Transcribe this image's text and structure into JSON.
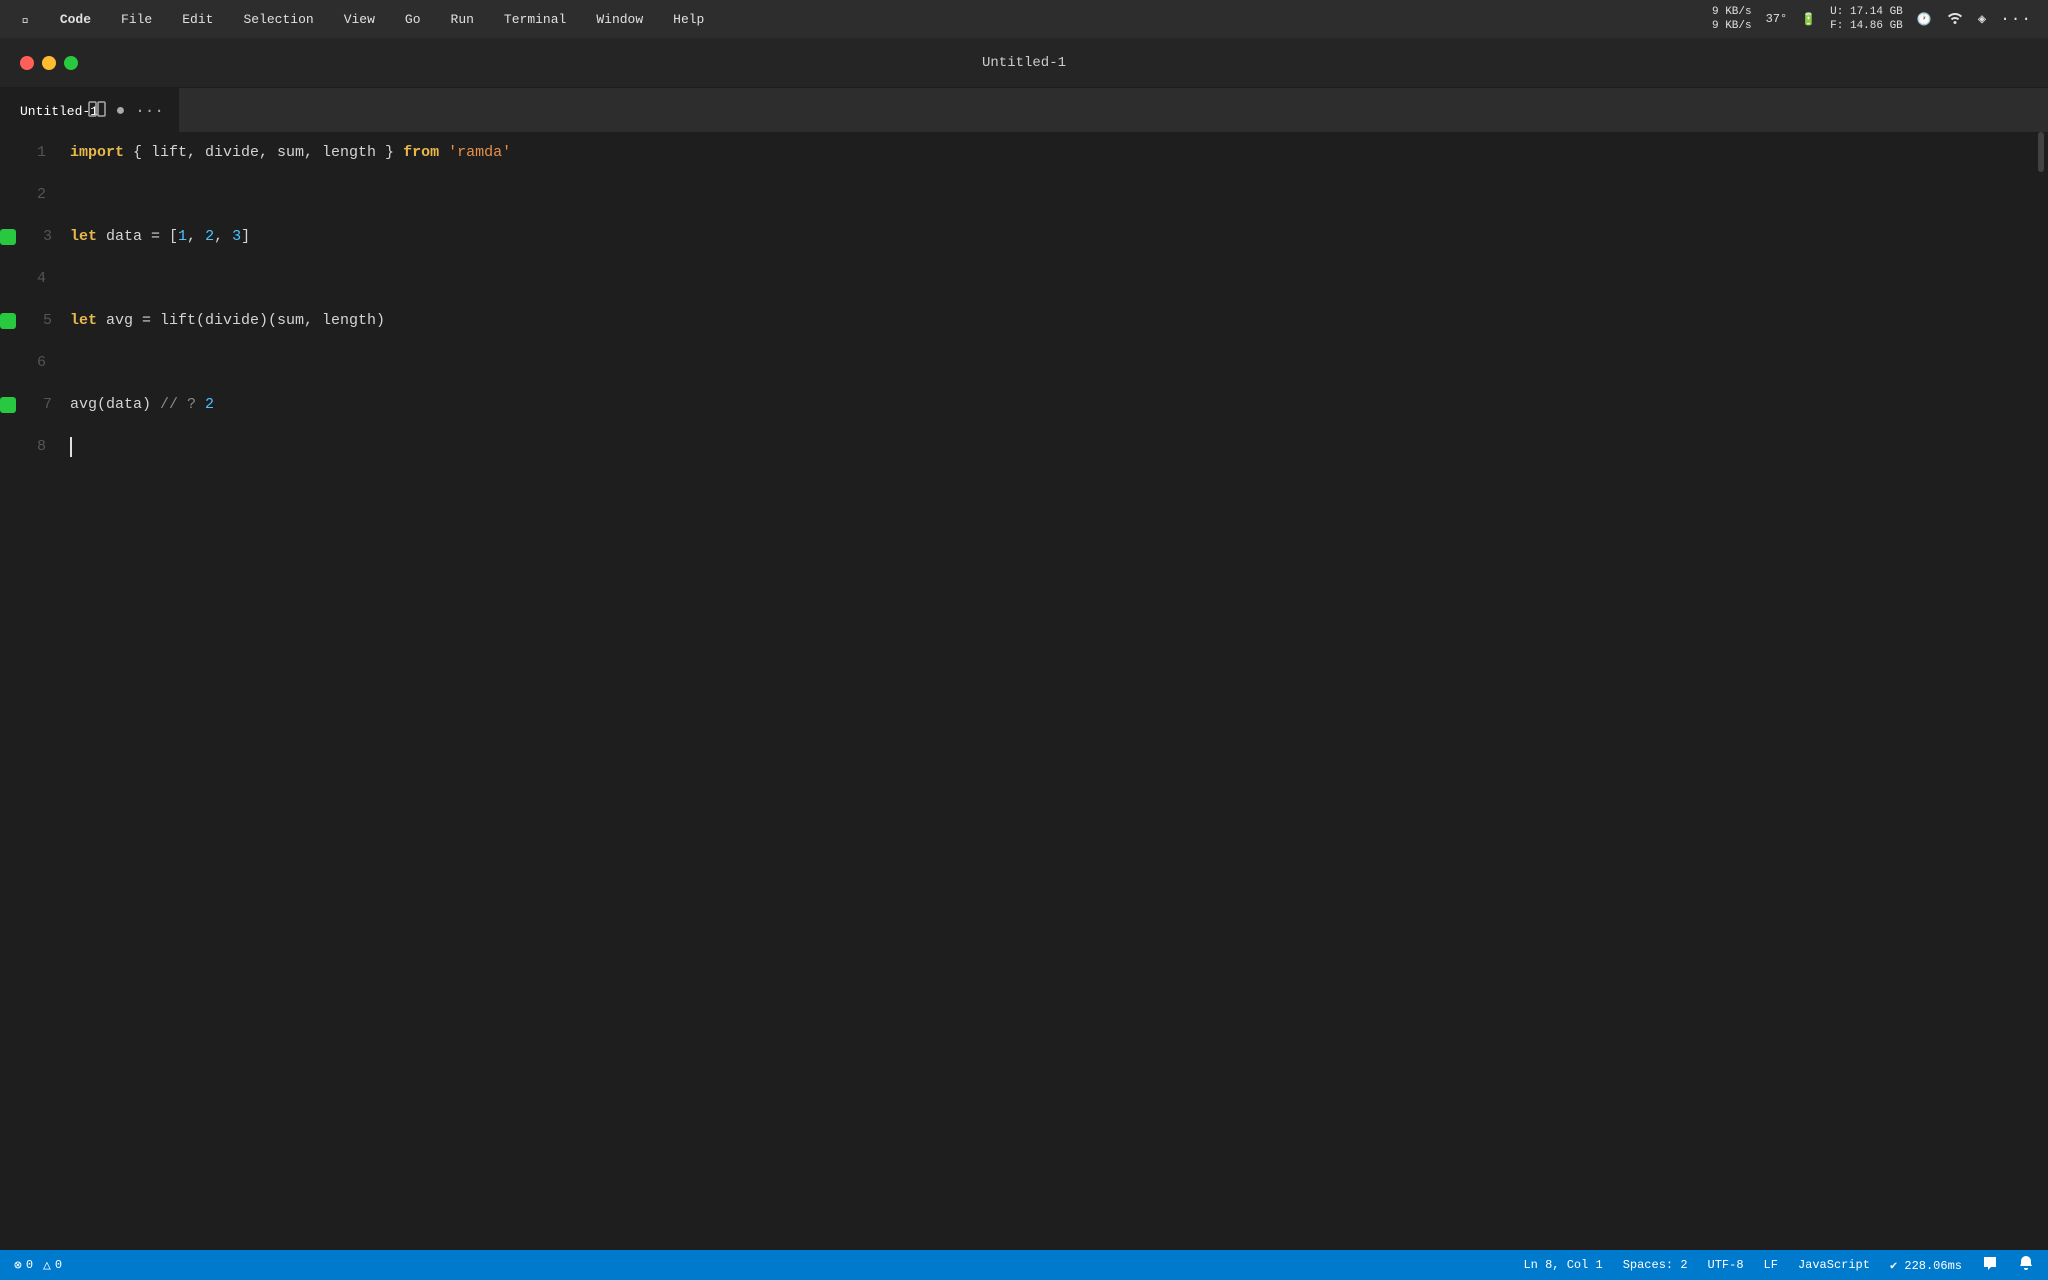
{
  "menubar": {
    "apple": "⌘",
    "items": [
      {
        "label": "Code",
        "bold": true
      },
      {
        "label": "File"
      },
      {
        "label": "Edit"
      },
      {
        "label": "Selection"
      },
      {
        "label": "View"
      },
      {
        "label": "Go"
      },
      {
        "label": "Run"
      },
      {
        "label": "Terminal"
      },
      {
        "label": "Window"
      },
      {
        "label": "Help"
      }
    ],
    "right": {
      "network_up": "9 KB/s",
      "network_down": "9 KB/s",
      "temperature": "37°",
      "battery": "🔋",
      "disk_u": "U: 17.14 GB",
      "disk_f": "F: 14.86 GB",
      "clock_icon": "🕐",
      "wifi_icon": "wifi",
      "airdrop_icon": "◈",
      "more_icon": "···"
    }
  },
  "titlebar": {
    "title": "Untitled-1"
  },
  "tabs": [
    {
      "label": "Untitled-1",
      "active": true
    }
  ],
  "code": {
    "lines": [
      {
        "number": "1",
        "indicator": false,
        "tokens": [
          {
            "text": "import",
            "class": "kw"
          },
          {
            "text": " { lift, divide, sum, length } ",
            "class": "plain"
          },
          {
            "text": "from",
            "class": "from-kw"
          },
          {
            "text": " ",
            "class": "plain"
          },
          {
            "text": "'ramda'",
            "class": "str"
          }
        ]
      },
      {
        "number": "2",
        "indicator": false,
        "tokens": []
      },
      {
        "number": "3",
        "indicator": true,
        "tokens": [
          {
            "text": "let",
            "class": "kw"
          },
          {
            "text": " data = [",
            "class": "plain"
          },
          {
            "text": "1",
            "class": "num"
          },
          {
            "text": ", ",
            "class": "plain"
          },
          {
            "text": "2",
            "class": "num"
          },
          {
            "text": ", ",
            "class": "plain"
          },
          {
            "text": "3",
            "class": "num"
          },
          {
            "text": "]",
            "class": "plain"
          }
        ]
      },
      {
        "number": "4",
        "indicator": false,
        "tokens": []
      },
      {
        "number": "5",
        "indicator": true,
        "tokens": [
          {
            "text": "let",
            "class": "kw"
          },
          {
            "text": " avg = lift(divide)(sum, length)",
            "class": "plain"
          }
        ]
      },
      {
        "number": "6",
        "indicator": false,
        "tokens": []
      },
      {
        "number": "7",
        "indicator": true,
        "tokens": [
          {
            "text": "avg(data) ",
            "class": "plain"
          },
          {
            "text": "// ? ",
            "class": "comment"
          },
          {
            "text": "2",
            "class": "num"
          }
        ]
      },
      {
        "number": "8",
        "indicator": false,
        "tokens": []
      }
    ]
  },
  "statusbar": {
    "errors": "0",
    "warnings": "0",
    "position": "Ln 8, Col 1",
    "spaces": "Spaces: 2",
    "encoding": "UTF-8",
    "line_ending": "LF",
    "language": "JavaScript",
    "timing": "✔ 228.06ms",
    "feedback_icon": "💬",
    "bell_icon": "🔔"
  }
}
